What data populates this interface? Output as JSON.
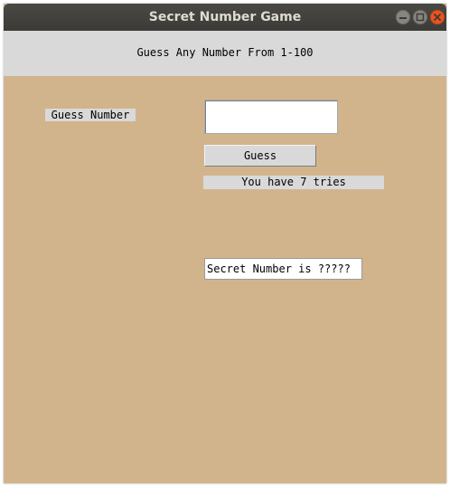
{
  "window": {
    "title": "Secret Number Game"
  },
  "banner": {
    "text": "Guess Any Number From 1-100"
  },
  "form": {
    "guess_label": "Guess Number",
    "guess_input_value": "",
    "guess_button_label": "Guess",
    "tries_text": "You have 7 tries",
    "secret_text": "Secret Number is ?????"
  },
  "icons": {
    "minimize": "minimize-icon",
    "maximize": "maximize-icon",
    "close": "close-icon"
  },
  "colors": {
    "background": "#d2b48c",
    "panel": "#d9d9d9",
    "titlebar": "#3c3b37",
    "close_button": "#e9541f"
  }
}
